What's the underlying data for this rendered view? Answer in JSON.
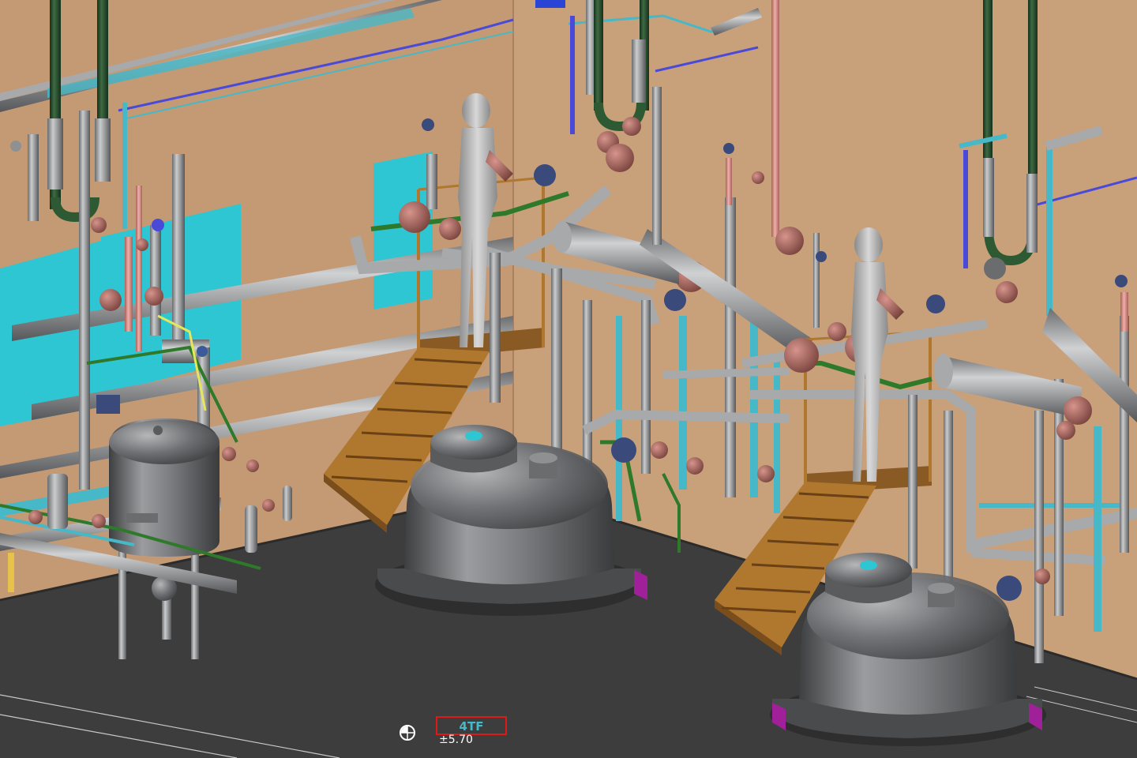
{
  "scene": {
    "description_type": "cad-3d-plant-model",
    "colors": {
      "wall": "#c49a74",
      "wall_shade": "#a98160",
      "floor": "#3d3d3d",
      "floor_edge": "#2e2e2e",
      "window": "#2ec6d2",
      "steel": "#a7a9ab",
      "steel_dark": "#5c5e60",
      "pipe_green": "#2e7a2a",
      "pipe_dark_green": "#23472a",
      "pipe_blue": "#4a4ad8",
      "pipe_cyan": "#47b8c7",
      "pipe_pink": "#e29a94",
      "valve": "#9a5a52",
      "stair": "#b0772f",
      "figure": "#b8b8b8",
      "nozzle": "#a0209a",
      "tag_red": "#e01818",
      "tag_white": "#ffffff"
    },
    "floor_marker": {
      "tag_label": "4TF",
      "elevation": "±5.70"
    }
  }
}
